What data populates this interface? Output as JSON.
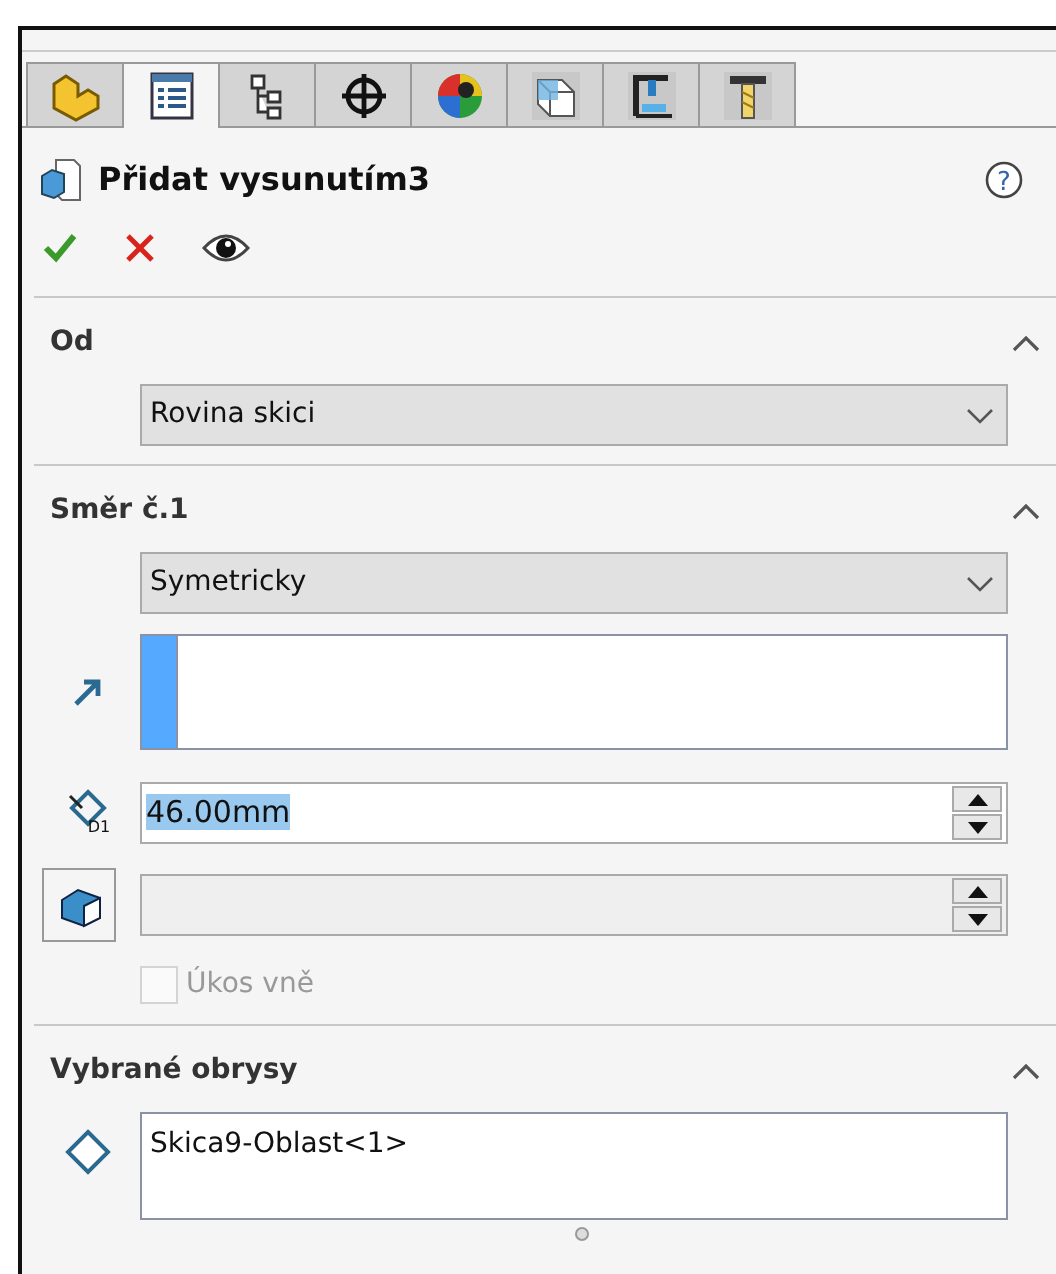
{
  "tabs": [
    {
      "selected": false
    },
    {
      "selected": true
    },
    {
      "selected": false
    },
    {
      "selected": false
    },
    {
      "selected": false
    },
    {
      "selected": false
    },
    {
      "selected": false
    },
    {
      "selected": false
    }
  ],
  "feature": {
    "title": "Přidat vysunutím3",
    "help": "?"
  },
  "sections": [
    {
      "kind": "from",
      "title": "Od",
      "expanded": true,
      "dropdown": "Rovina skici"
    },
    {
      "kind": "direction",
      "title": "Směr č.1",
      "expanded": true,
      "dropdown": "Symetricky",
      "depth": {
        "icon_label": "D1",
        "value": "46.00mm",
        "text_selected": true
      },
      "draft_disabled": true,
      "draft_outward": {
        "label": "Úkos vně",
        "checked": false,
        "disabled": true
      }
    },
    {
      "kind": "contours",
      "title": "Vybrané obrysy",
      "expanded": true,
      "items": [
        "Skica9-Oblast<1>"
      ]
    }
  ]
}
